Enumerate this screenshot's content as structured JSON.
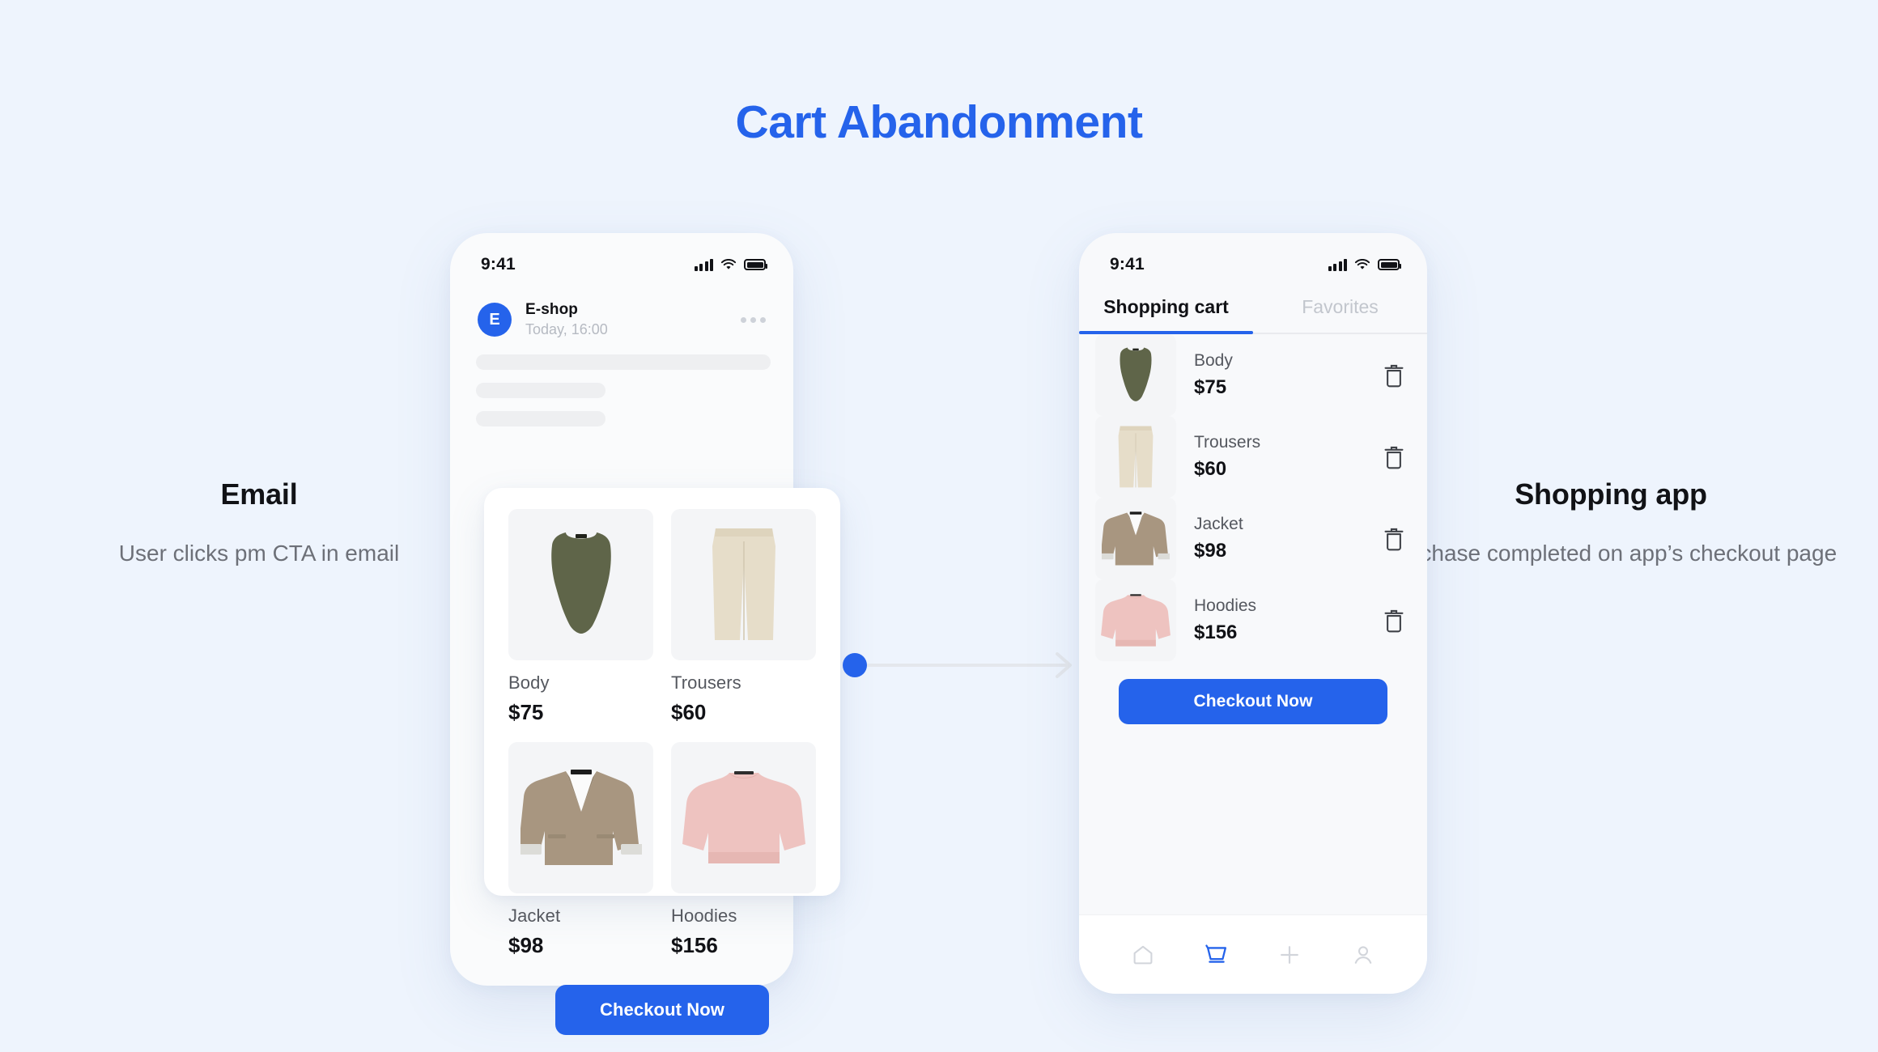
{
  "page": {
    "title": "Cart Abandonment",
    "accent_color": "#2563eb",
    "background_color": "#eef4fd"
  },
  "caption_left": {
    "title": "Email",
    "subtitle": "User clicks pm CTA in email"
  },
  "caption_right": {
    "title": "Shopping app",
    "subtitle": "Purchase completed on app’s checkout page"
  },
  "email_phone": {
    "status": {
      "time": "9:41",
      "signal_icon": "signal-bars-icon",
      "wifi_icon": "wifi-icon",
      "battery_icon": "battery-icon"
    },
    "mail": {
      "avatar_initial": "E",
      "sender": "E-shop",
      "timestamp": "Today, 16:00",
      "more_icon": "more-options-icon"
    },
    "products": [
      {
        "name": "Body",
        "price": "$75",
        "image": "olive-bodysuit",
        "color": "#5f6549"
      },
      {
        "name": "Trousers",
        "price": "$60",
        "image": "cream-trousers",
        "color": "#e6ddc9"
      },
      {
        "name": "Jacket",
        "price": "$98",
        "image": "taupe-blazer",
        "color": "#a89680"
      },
      {
        "name": "Hoodies",
        "price": "$156",
        "image": "pink-sweatshirt",
        "color": "#eec3c0"
      }
    ],
    "checkout_label": "Checkout Now"
  },
  "app_phone": {
    "status": {
      "time": "9:41",
      "signal_icon": "signal-bars-icon",
      "wifi_icon": "wifi-icon",
      "battery_icon": "battery-icon"
    },
    "tabs": [
      {
        "label": "Shopping cart",
        "active": true
      },
      {
        "label": "Favorites",
        "active": false
      }
    ],
    "cart_items": [
      {
        "name": "Body",
        "price": "$75",
        "image": "olive-bodysuit",
        "color": "#5f6549",
        "delete_icon": "trash-icon"
      },
      {
        "name": "Trousers",
        "price": "$60",
        "image": "cream-trousers",
        "color": "#e6ddc9",
        "delete_icon": "trash-icon"
      },
      {
        "name": "Jacket",
        "price": "$98",
        "image": "taupe-blazer",
        "color": "#a89680",
        "delete_icon": "trash-icon"
      },
      {
        "name": "Hoodies",
        "price": "$156",
        "image": "pink-sweatshirt",
        "color": "#eec3c0",
        "delete_icon": "trash-icon"
      }
    ],
    "checkout_label": "Checkout Now",
    "bottom_nav": [
      {
        "icon": "home-icon",
        "active": false
      },
      {
        "icon": "cart-icon",
        "active": true
      },
      {
        "icon": "plus-icon",
        "active": false
      },
      {
        "icon": "profile-icon",
        "active": false
      }
    ]
  },
  "connector": {
    "start_dot_icon": "connector-dot",
    "arrow_icon": "arrow-right-icon"
  }
}
